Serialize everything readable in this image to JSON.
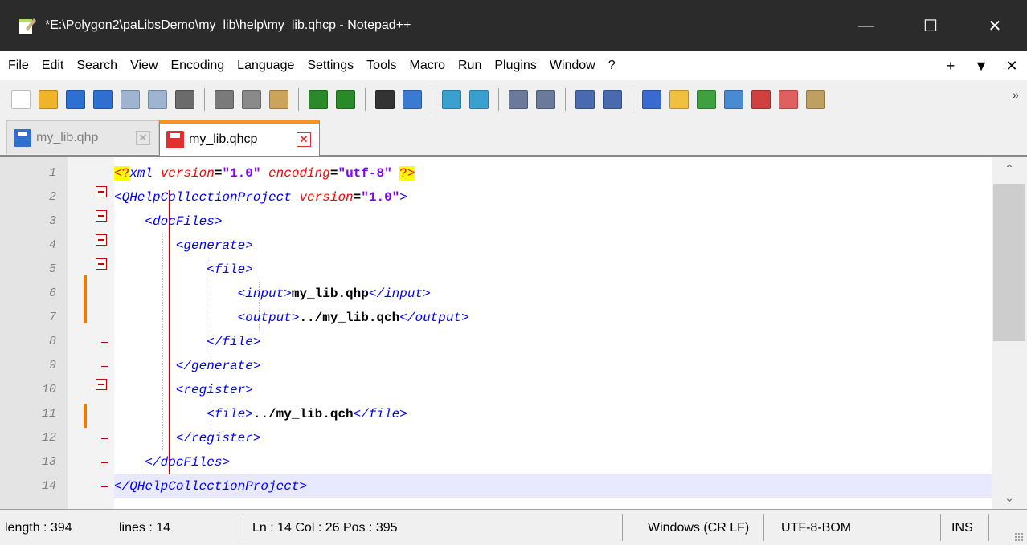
{
  "window": {
    "title": "*E:\\Polygon2\\paLibsDemo\\my_lib\\help\\my_lib.qhcp - Notepad++",
    "minimize": "—",
    "maximize": "☐",
    "close": "✕"
  },
  "menu": {
    "items": [
      "File",
      "Edit",
      "Search",
      "View",
      "Encoding",
      "Language",
      "Settings",
      "Tools",
      "Macro",
      "Run",
      "Plugins",
      "Window",
      "?"
    ],
    "right": [
      "+",
      "▼",
      "✕"
    ]
  },
  "toolbar": {
    "overflow": "»",
    "buttons": [
      {
        "name": "new-file-icon",
        "color": "#ffffff"
      },
      {
        "name": "open-file-icon",
        "color": "#f0b429"
      },
      {
        "name": "save-icon",
        "color": "#2f6fd1"
      },
      {
        "name": "save-all-icon",
        "color": "#2f6fd1"
      },
      {
        "name": "close-icon",
        "color": "#9fb4d0"
      },
      {
        "name": "close-all-icon",
        "color": "#9fb4d0"
      },
      {
        "name": "print-icon",
        "color": "#6b6b6b"
      },
      {
        "name": "cut-icon",
        "color": "#7a7a7a"
      },
      {
        "name": "copy-icon",
        "color": "#8a8a8a"
      },
      {
        "name": "paste-icon",
        "color": "#c9a45a"
      },
      {
        "name": "undo-icon",
        "color": "#2a8a2a"
      },
      {
        "name": "redo-icon",
        "color": "#2a8a2a"
      },
      {
        "name": "find-icon",
        "color": "#333333"
      },
      {
        "name": "replace-icon",
        "color": "#3a7ad0"
      },
      {
        "name": "zoom-in-icon",
        "color": "#3aa0d0"
      },
      {
        "name": "zoom-out-icon",
        "color": "#3aa0d0"
      },
      {
        "name": "sync-vertical-icon",
        "color": "#6a7a9a"
      },
      {
        "name": "sync-horizontal-icon",
        "color": "#6a7a9a"
      },
      {
        "name": "word-wrap-icon",
        "color": "#4a6ab0"
      },
      {
        "name": "show-all-chars-icon",
        "color": "#4a6ab0"
      },
      {
        "name": "indent-guide-icon",
        "color": "#3a6ad0"
      },
      {
        "name": "udl-icon",
        "color": "#f0c040"
      },
      {
        "name": "doc-map-icon",
        "color": "#40a040"
      },
      {
        "name": "function-list-icon",
        "color": "#4a8ad0"
      },
      {
        "name": "folder-workspace-icon",
        "color": "#d04040"
      },
      {
        "name": "monitoring-icon",
        "color": "#e06060"
      },
      {
        "name": "eye-icon",
        "color": "#c0a060"
      }
    ]
  },
  "tabs": [
    {
      "label": "my_lib.qhp",
      "close": "✕",
      "icon": "save-icon",
      "icon_color": "#2f6fd1"
    },
    {
      "label": "my_lib.qhcp",
      "close": "✕",
      "icon": "save-icon",
      "icon_color": "#e03030"
    }
  ],
  "editor": {
    "line_numbers": [
      "1",
      "2",
      "3",
      "4",
      "5",
      "6",
      "7",
      "8",
      "9",
      "10",
      "11",
      "12",
      "13",
      "14"
    ],
    "lines": [
      {
        "indent": "",
        "segments": [
          [
            "pi",
            "<?"
          ],
          [
            "tag",
            "xml "
          ],
          [
            "attr",
            "version"
          ],
          [
            "txt",
            "="
          ],
          [
            "val",
            "\"1.0\" "
          ],
          [
            "attr",
            "encoding"
          ],
          [
            "txt",
            "="
          ],
          [
            "val",
            "\"utf-8\" "
          ],
          [
            "pi",
            "?>"
          ]
        ]
      },
      {
        "indent": "",
        "segments": [
          [
            "tag",
            "<QHelpCollectionProject "
          ],
          [
            "attr",
            "version"
          ],
          [
            "txt",
            "="
          ],
          [
            "val",
            "\"1.0\""
          ],
          [
            "tag",
            ">"
          ]
        ]
      },
      {
        "indent": "    ",
        "segments": [
          [
            "tag",
            "<docFiles>"
          ]
        ]
      },
      {
        "indent": "        ",
        "segments": [
          [
            "tag",
            "<generate>"
          ]
        ]
      },
      {
        "indent": "            ",
        "segments": [
          [
            "tag",
            "<file>"
          ]
        ]
      },
      {
        "indent": "                ",
        "segments": [
          [
            "tag",
            "<input>"
          ],
          [
            "txt",
            "my_lib.qhp"
          ],
          [
            "tag",
            "</input>"
          ]
        ]
      },
      {
        "indent": "                ",
        "segments": [
          [
            "tag",
            "<output>"
          ],
          [
            "txt",
            "../my_lib.qch"
          ],
          [
            "tag",
            "</output>"
          ]
        ]
      },
      {
        "indent": "            ",
        "segments": [
          [
            "tag",
            "</file>"
          ]
        ]
      },
      {
        "indent": "        ",
        "segments": [
          [
            "tag",
            "</generate>"
          ]
        ]
      },
      {
        "indent": "        ",
        "segments": [
          [
            "tag",
            "<register>"
          ]
        ]
      },
      {
        "indent": "            ",
        "segments": [
          [
            "tag",
            "<file>"
          ],
          [
            "txt",
            "../my_lib.qch"
          ],
          [
            "tag",
            "</file>"
          ]
        ]
      },
      {
        "indent": "        ",
        "segments": [
          [
            "tag",
            "</register>"
          ]
        ]
      },
      {
        "indent": "    ",
        "segments": [
          [
            "tag",
            "</docFiles>"
          ]
        ]
      },
      {
        "indent": "",
        "segments": [
          [
            "tag",
            "</QHelpCollectionProject>"
          ]
        ]
      }
    ],
    "current_line": 14
  },
  "status": {
    "length": "length : 394",
    "lines": "lines : 14",
    "position": "Ln : 14    Col : 26    Pos : 395",
    "eol": "Windows (CR LF)",
    "encoding": "UTF-8-BOM",
    "mode": "INS"
  }
}
